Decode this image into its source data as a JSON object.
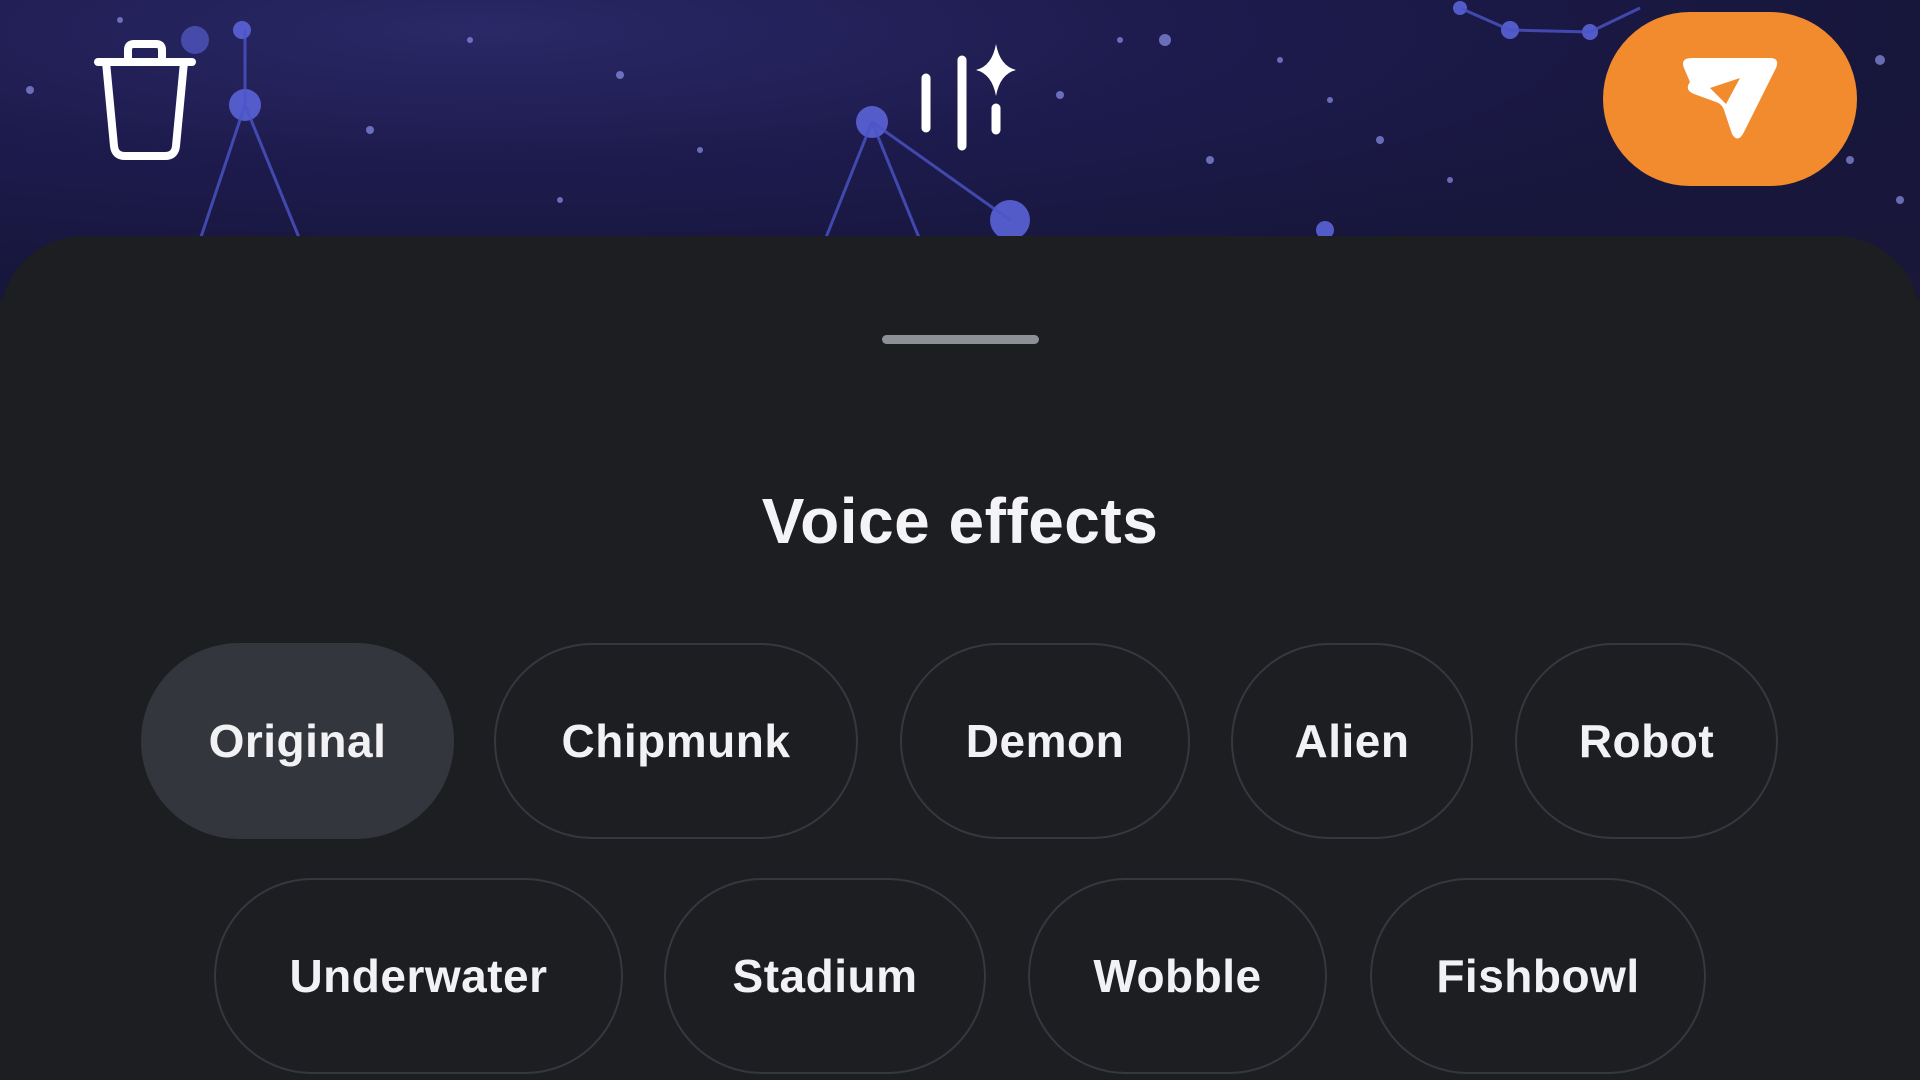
{
  "header": {
    "delete_icon": "trash-icon",
    "effects_icon": "voice-effects-sparkle-icon",
    "send_icon": "send-arrow-icon",
    "send_color": "#f28a2e"
  },
  "sheet": {
    "title": "Voice effects",
    "selected": "Original",
    "effects": [
      {
        "label": "Original"
      },
      {
        "label": "Chipmunk"
      },
      {
        "label": "Demon"
      },
      {
        "label": "Alien"
      },
      {
        "label": "Robot"
      },
      {
        "label": "Underwater"
      },
      {
        "label": "Stadium"
      },
      {
        "label": "Wobble"
      },
      {
        "label": "Fishbowl"
      }
    ]
  }
}
